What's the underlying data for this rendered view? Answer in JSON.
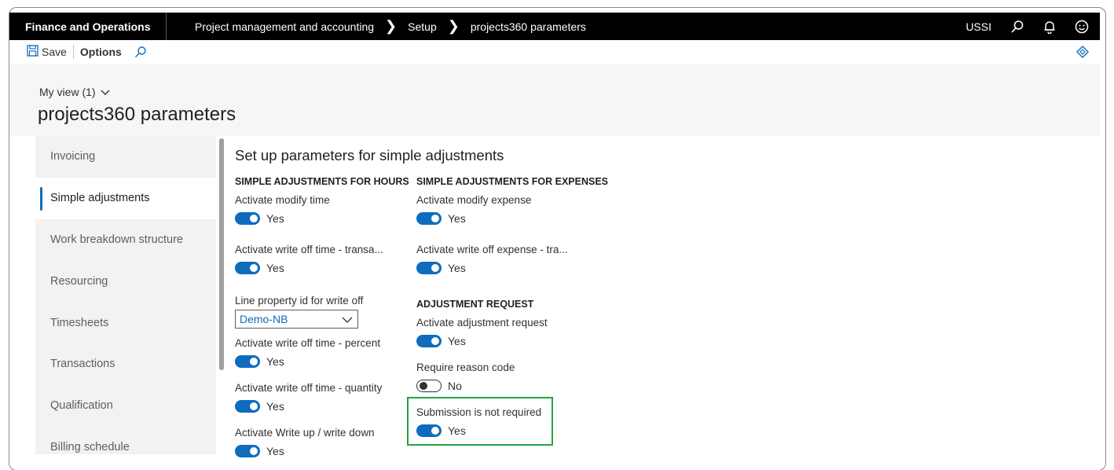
{
  "topbar": {
    "app_name": "Finance and Operations",
    "breadcrumbs": [
      "Project management and accounting",
      "Setup",
      "projects360 parameters"
    ],
    "company": "USSI",
    "icons": [
      "search-icon",
      "bell-icon",
      "smiley-icon"
    ]
  },
  "actionbar": {
    "save_label": "Save",
    "options_label": "Options"
  },
  "header": {
    "view_label": "My view (1)",
    "page_title": "projects360 parameters"
  },
  "sidenav": {
    "items": [
      {
        "label": "Invoicing",
        "active": false
      },
      {
        "label": "Simple adjustments",
        "active": true
      },
      {
        "label": "Work breakdown structure",
        "active": false
      },
      {
        "label": "Resourcing",
        "active": false
      },
      {
        "label": "Timesheets",
        "active": false
      },
      {
        "label": "Transactions",
        "active": false
      },
      {
        "label": "Qualification",
        "active": false
      },
      {
        "label": "Billing schedule",
        "active": false
      }
    ]
  },
  "content": {
    "section_title": "Set up parameters for simple adjustments",
    "hours": {
      "header": "SIMPLE ADJUSTMENTS FOR HOURS",
      "modify_time": {
        "label": "Activate modify time",
        "value": "Yes"
      },
      "write_off_trans": {
        "label": "Activate write off time - transa...",
        "value": "Yes"
      },
      "line_property": {
        "label": "Line property id for write off",
        "value": "Demo-NB"
      },
      "write_off_percent": {
        "label": "Activate write off time - percent",
        "value": "Yes"
      },
      "write_off_quantity": {
        "label": "Activate write off time - quantity",
        "value": "Yes"
      },
      "write_up_down": {
        "label": "Activate Write up / write down",
        "value": "Yes"
      }
    },
    "expenses": {
      "header": "SIMPLE ADJUSTMENTS FOR EXPENSES",
      "modify_expense": {
        "label": "Activate modify expense",
        "value": "Yes"
      },
      "write_off_expense": {
        "label": "Activate write off expense - tra...",
        "value": "Yes"
      }
    },
    "adjustment_request": {
      "header": "ADJUSTMENT REQUEST",
      "activate": {
        "label": "Activate adjustment request",
        "value": "Yes"
      },
      "reason_code": {
        "label": "Require reason code",
        "value": "No"
      },
      "submission": {
        "label": "Submission is not required",
        "value": "Yes"
      }
    }
  },
  "colors": {
    "accent": "#0f6cbd",
    "highlight_box": "#21a441",
    "topbar_bg": "#000000"
  }
}
